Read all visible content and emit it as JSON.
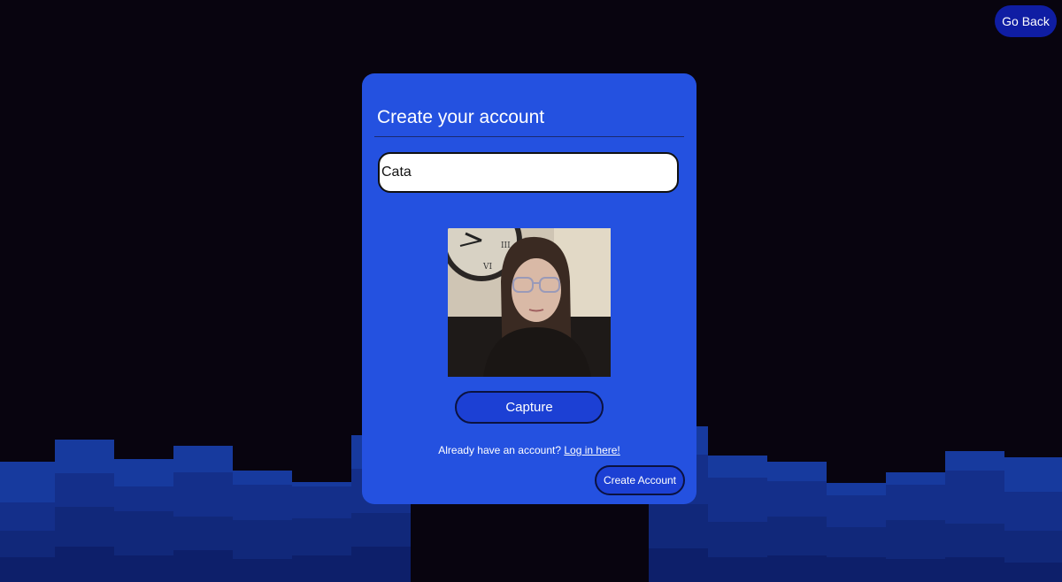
{
  "header": {
    "go_back_label": "Go Back"
  },
  "form": {
    "title": "Create your account",
    "name_value": "Cata",
    "camera_feed": "webcam-preview-image",
    "capture_label": "Capture",
    "login_prompt": "Already have an account?",
    "login_link_label": "Log in here!",
    "create_label": "Create Account"
  },
  "colors": {
    "background": "#08040f",
    "card": "#2451e0",
    "button": "#1c40d4",
    "go_back": "#0f1da3"
  }
}
